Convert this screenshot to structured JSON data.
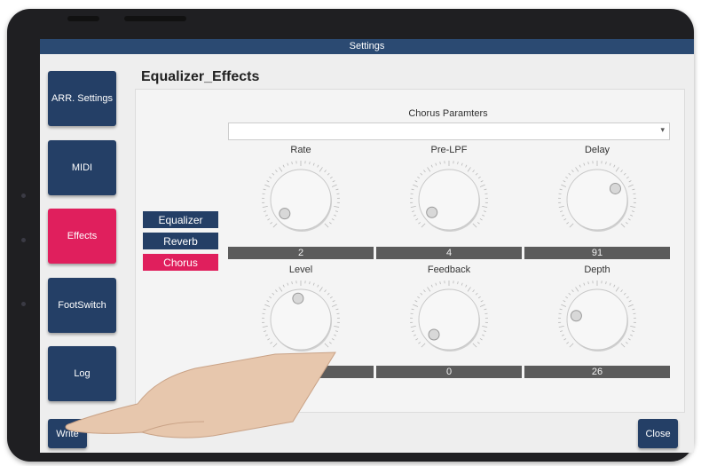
{
  "window": {
    "title": "Settings"
  },
  "sidebar": {
    "items": [
      {
        "label": "ARR. Settings",
        "active": false
      },
      {
        "label": "MIDI",
        "active": false
      },
      {
        "label": "Effects",
        "active": true
      },
      {
        "label": "FootSwitch",
        "active": false
      },
      {
        "label": "Log",
        "active": false
      }
    ]
  },
  "page": {
    "title": "Equalizer_Effects"
  },
  "tabs": [
    {
      "label": "Equalizer",
      "active": false
    },
    {
      "label": "Reverb",
      "active": false
    },
    {
      "label": "Chorus",
      "active": true
    }
  ],
  "chorus": {
    "section_title": "Chorus Paramters",
    "dropdown_value": "",
    "knobs": [
      {
        "label": "Rate",
        "value": "2"
      },
      {
        "label": "Pre-LPF",
        "value": "4"
      },
      {
        "label": "Delay",
        "value": "91"
      },
      {
        "label": "Level",
        "value": "60"
      },
      {
        "label": "Feedback",
        "value": "0"
      },
      {
        "label": "Depth",
        "value": "26"
      }
    ]
  },
  "footer": {
    "write_label": "Write",
    "close_label": "Close"
  },
  "colors": {
    "accent": "#e01f5d",
    "primary": "#243f66",
    "titlebar": "#2b4a72"
  }
}
